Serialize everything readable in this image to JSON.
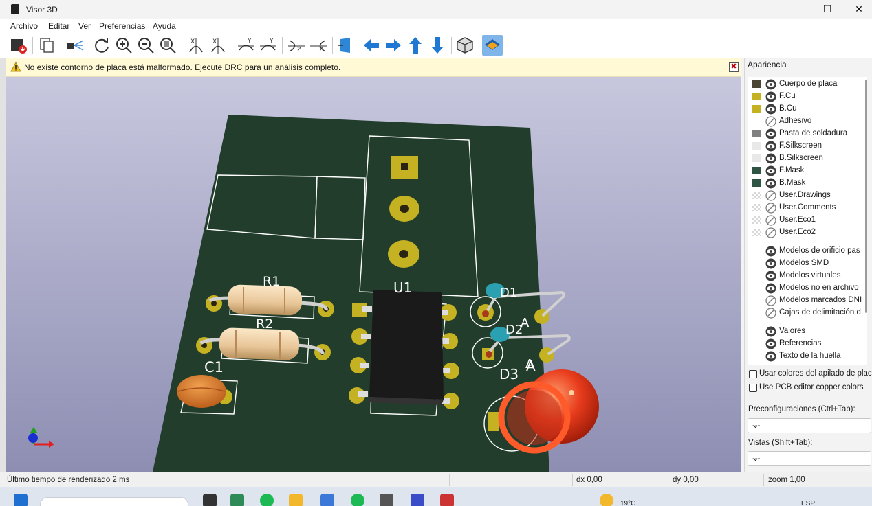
{
  "window": {
    "title": "Visor 3D",
    "controls": {
      "minimize": "—",
      "maximize": "☐",
      "close": "✕"
    }
  },
  "menu": {
    "items": [
      "Archivo",
      "Editar",
      "Ver",
      "Preferencias",
      "Ayuda"
    ]
  },
  "toolbar": {
    "buttons": [
      "export-image-icon",
      "copy-icon",
      "raytrace-icon",
      "reload-icon",
      "zoom-in-icon",
      "zoom-out-icon",
      "zoom-fit-icon",
      "rotate-x-cw-icon",
      "rotate-x-ccw-icon",
      "rotate-y-cw-icon",
      "rotate-y-ccw-icon",
      "rotate-z-cw-icon",
      "rotate-z-ccw-icon",
      "flip-board-icon",
      "move-left-icon",
      "move-right-icon",
      "move-up-icon",
      "move-down-icon",
      "orthographic-icon",
      "layers-panel-icon"
    ],
    "active_button": "layers-panel-icon"
  },
  "warning": {
    "text": "No existe contorno de placa está malformado. Ejecute DRC para un análisis completo.",
    "close_glyph": "✖"
  },
  "board": {
    "references": {
      "r1": "R1",
      "r2": "R2",
      "c1": "C1",
      "u1": "U1",
      "d1": "D1",
      "d2": "D2",
      "d3": "D3"
    },
    "pad_labels": {
      "d1_anode": "A",
      "d2_anode": "A",
      "d3_anode": "A"
    },
    "colors": {
      "mask": "#223d2b",
      "copper": "#c4b222",
      "silkscreen": "#ffffff",
      "background_top": "#c7c7de",
      "background_bottom": "#8e8eb3"
    }
  },
  "appearance": {
    "title": "Apariencia",
    "layers": [
      {
        "name": "Cuerpo de placa",
        "color": "#4a4433",
        "visible": true
      },
      {
        "name": "F.Cu",
        "color": "#c4b222",
        "visible": true
      },
      {
        "name": "B.Cu",
        "color": "#c4b222",
        "visible": true
      },
      {
        "name": "Adhesivo",
        "color": "",
        "visible": false
      },
      {
        "name": "Pasta de soldadura",
        "color": "#808080",
        "visible": true
      },
      {
        "name": "F.Silkscreen",
        "color": "#e8e8e8",
        "visible": true
      },
      {
        "name": "B.Silkscreen",
        "color": "#e8e8e8",
        "visible": true
      },
      {
        "name": "F.Mask",
        "color": "#2e5443",
        "visible": true
      },
      {
        "name": "B.Mask",
        "color": "#2e5443",
        "visible": true
      },
      {
        "name": "User.Drawings",
        "color": "checker",
        "visible": false
      },
      {
        "name": "User.Comments",
        "color": "checker",
        "visible": false
      },
      {
        "name": "User.Eco1",
        "color": "checker",
        "visible": false
      },
      {
        "name": "User.Eco2",
        "color": "checker",
        "visible": false
      }
    ],
    "models": [
      {
        "name": "Modelos de orificio pas",
        "visible": true
      },
      {
        "name": "Modelos SMD",
        "visible": true
      },
      {
        "name": "Modelos virtuales",
        "visible": true
      },
      {
        "name": "Modelos no en archivo",
        "visible": true
      },
      {
        "name": "Modelos marcados DNI",
        "visible": false
      },
      {
        "name": "Cajas de delimitación d",
        "visible": false
      }
    ],
    "texts": [
      {
        "name": "Valores",
        "visible": true
      },
      {
        "name": "Referencias",
        "visible": true
      },
      {
        "name": "Texto de la huella",
        "visible": true
      }
    ],
    "checkboxes": [
      {
        "label": "Usar colores del apilado de plac",
        "checked": false
      },
      {
        "label": "Use PCB editor copper colors",
        "checked": false
      }
    ],
    "presets_label": "Preconfiguraciones (Ctrl+Tab):",
    "presets_value": "---",
    "views_label": "Vistas (Shift+Tab):",
    "views_value": "---"
  },
  "status": {
    "render_time": "Último tiempo de renderizado 2 ms",
    "dx": "dx 0,00",
    "dy": "dy 0,00",
    "zoom": "zoom 1,00"
  },
  "taskbar": {
    "weather": "19°C",
    "language": "ESP"
  }
}
